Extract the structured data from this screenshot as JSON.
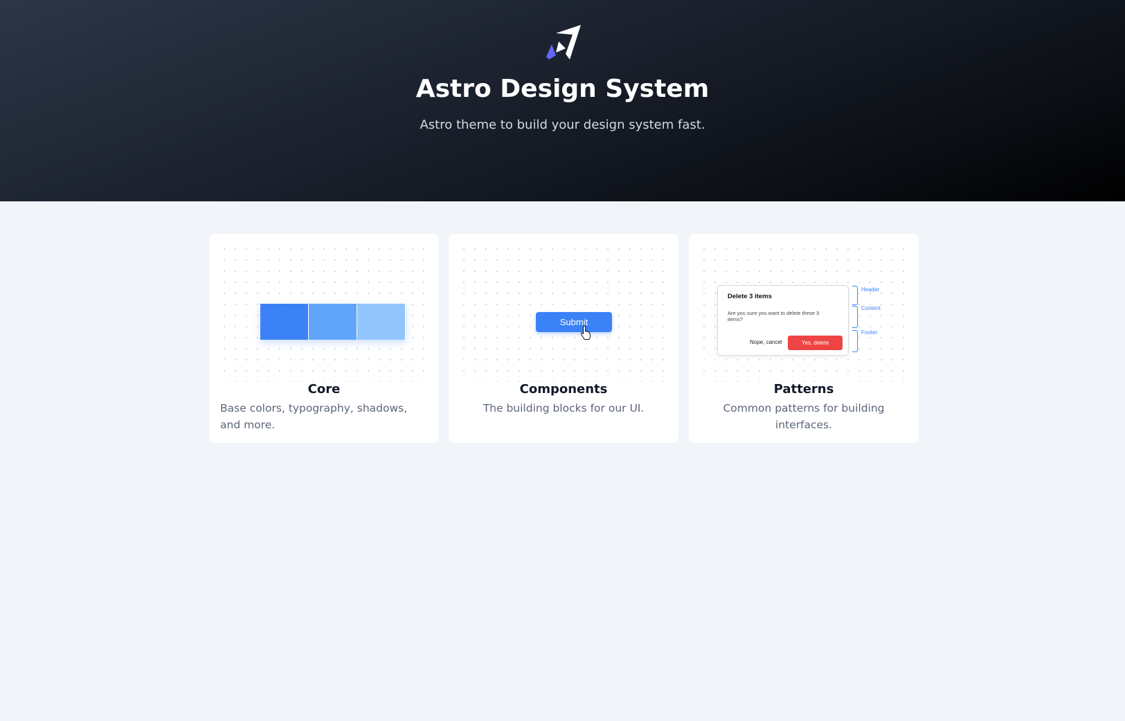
{
  "hero": {
    "logo_icon": "astro-rocket-icon",
    "title": "Astro Design System",
    "subtitle": "Astro theme to build your design system fast."
  },
  "cards": [
    {
      "title": "Core",
      "description": "Base colors, typography, shadows, and more.",
      "swatch_colors": [
        "#3b82f6",
        "#60a5fa",
        "#93c5fd"
      ]
    },
    {
      "title": "Components",
      "description": "The building blocks for our UI.",
      "button_label": "Submit",
      "cursor_icon": "pointer-hand-icon"
    },
    {
      "title": "Patterns",
      "description": "Common patterns for building interfaces.",
      "dialog": {
        "title": "Delete 3 items",
        "body": "Are you sure you want to delete these 3 items?",
        "cancel_label": "Nope, cancel",
        "confirm_label": "Yes, delete"
      },
      "annotations": [
        "Header",
        "Content",
        "Footer"
      ]
    }
  ],
  "colors": {
    "accent": "#3b82f6",
    "danger": "#ef4444",
    "page_background": "#f1f4f8"
  }
}
